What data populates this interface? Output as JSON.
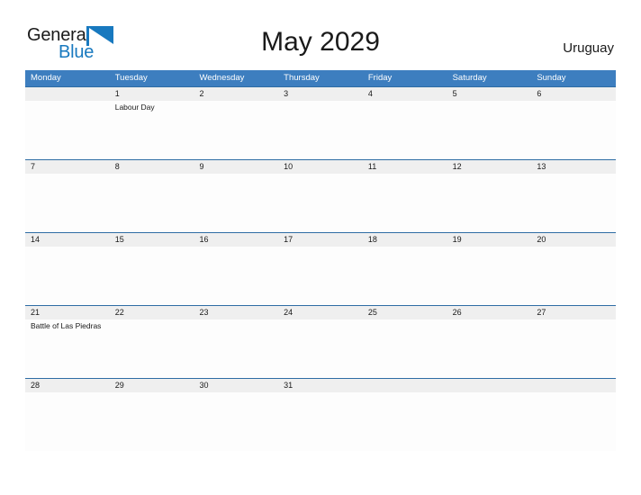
{
  "brand": {
    "name_part1": "General",
    "name_part2": "Blue",
    "accent_color": "#1879bf"
  },
  "header": {
    "title": "May 2029",
    "country": "Uruguay"
  },
  "theme": {
    "header_bar_color": "#3d7ebf",
    "date_band_color": "#efefef",
    "rule_color": "#2e6da4",
    "text_color": "#1a1a1a"
  },
  "weekdays": [
    "Monday",
    "Tuesday",
    "Wednesday",
    "Thursday",
    "Friday",
    "Saturday",
    "Sunday"
  ],
  "weeks": [
    {
      "days": [
        {
          "num": "",
          "event": ""
        },
        {
          "num": "1",
          "event": "Labour Day"
        },
        {
          "num": "2",
          "event": ""
        },
        {
          "num": "3",
          "event": ""
        },
        {
          "num": "4",
          "event": ""
        },
        {
          "num": "5",
          "event": ""
        },
        {
          "num": "6",
          "event": ""
        }
      ]
    },
    {
      "days": [
        {
          "num": "7",
          "event": ""
        },
        {
          "num": "8",
          "event": ""
        },
        {
          "num": "9",
          "event": ""
        },
        {
          "num": "10",
          "event": ""
        },
        {
          "num": "11",
          "event": ""
        },
        {
          "num": "12",
          "event": ""
        },
        {
          "num": "13",
          "event": ""
        }
      ]
    },
    {
      "days": [
        {
          "num": "14",
          "event": ""
        },
        {
          "num": "15",
          "event": ""
        },
        {
          "num": "16",
          "event": ""
        },
        {
          "num": "17",
          "event": ""
        },
        {
          "num": "18",
          "event": ""
        },
        {
          "num": "19",
          "event": ""
        },
        {
          "num": "20",
          "event": ""
        }
      ]
    },
    {
      "days": [
        {
          "num": "21",
          "event": "Battle of Las Piedras"
        },
        {
          "num": "22",
          "event": ""
        },
        {
          "num": "23",
          "event": ""
        },
        {
          "num": "24",
          "event": ""
        },
        {
          "num": "25",
          "event": ""
        },
        {
          "num": "26",
          "event": ""
        },
        {
          "num": "27",
          "event": ""
        }
      ]
    },
    {
      "days": [
        {
          "num": "28",
          "event": ""
        },
        {
          "num": "29",
          "event": ""
        },
        {
          "num": "30",
          "event": ""
        },
        {
          "num": "31",
          "event": ""
        },
        {
          "num": "",
          "event": ""
        },
        {
          "num": "",
          "event": ""
        },
        {
          "num": "",
          "event": ""
        }
      ]
    }
  ]
}
